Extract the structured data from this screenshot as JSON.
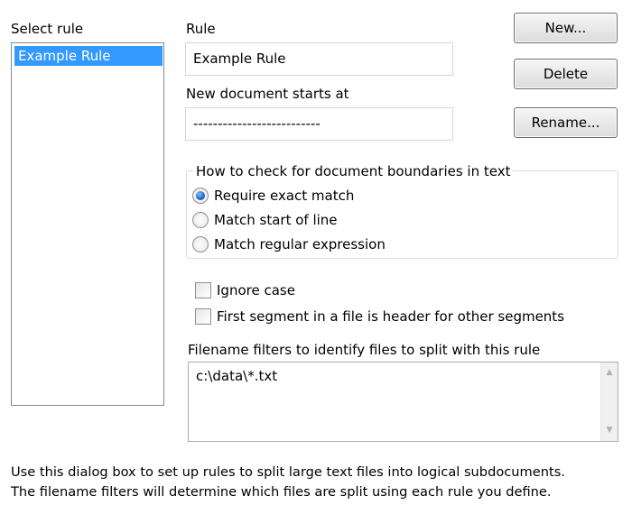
{
  "rules_panel": {
    "label": "Select rule",
    "items": [
      "Example Rule"
    ]
  },
  "rule": {
    "label": "Rule",
    "value": "Example Rule"
  },
  "new_document": {
    "label": "New document starts at",
    "value": "--------------------------"
  },
  "buttons": {
    "new": "New...",
    "delete": "Delete",
    "rename": "Rename..."
  },
  "boundary_group": {
    "legend": "How to check for document boundaries in text",
    "options": [
      "Require exact match",
      "Match start of line",
      "Match regular expression"
    ],
    "selected_index": 0
  },
  "options": {
    "ignore_case": "Ignore case",
    "first_segment_header": "First segment in a file is header for other segments"
  },
  "filename_filters": {
    "label": "Filename filters to identify files to split with this rule",
    "value": "c:\\data\\*.txt"
  },
  "footer": {
    "line1": "Use this dialog box to set up rules to split large text files into logical subdocuments.",
    "line2": "The filename filters will determine which files are split using each rule you define."
  },
  "colors": {
    "selection": "#3399ff",
    "radio_checked": "#1a62c8"
  }
}
